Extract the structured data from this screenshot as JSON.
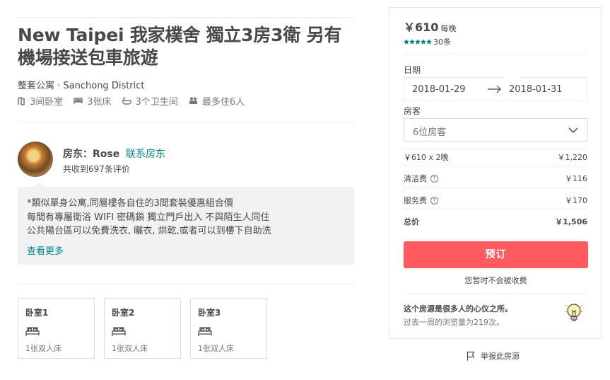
{
  "listing": {
    "title": "New Taipei 我家樸舍 獨立3房3衛 另有機場接送包車旅遊",
    "subtitle": "整套公寓 · Sanchong District",
    "bedrooms": "3间卧室",
    "beds": "3张床",
    "bathrooms": "3个卫生间",
    "guests": "最多住6人"
  },
  "host": {
    "name": "房东：Rose",
    "contact": "联系房东",
    "reviews": "共收到697条评价"
  },
  "description": {
    "lines": [
      "*類似單身公寓,同層樓各自住的3間套裝優惠組合價",
      "每間有專屬衛浴 WIFI 密碼鎖 獨立門戶出入 不與陌生人同住",
      "公共陽台區可以免費洗衣, 曬衣, 烘乾,或者可以到樓下自助洗"
    ],
    "read_more": "查看更多"
  },
  "rooms": [
    {
      "name": "卧室1",
      "bed": "1张双人床"
    },
    {
      "name": "卧室2",
      "bed": "1张双人床"
    },
    {
      "name": "卧室3",
      "bed": "1张双人床"
    }
  ],
  "booking": {
    "price": "￥610",
    "per_night": "每晚",
    "rating": 5,
    "review_count": "30条",
    "dates_label": "日期",
    "check_in": "2018-01-29",
    "check_out": "2018-01-31",
    "guests_label": "房客",
    "guests_value": "6位房客",
    "nights_line": "￥610 x 2晚",
    "nights_total": "￥1,220",
    "cleaning_label": "清洁费",
    "cleaning_fee": "￥116",
    "service_label": "服务费",
    "service_fee": "￥170",
    "total_label": "总价",
    "total": "￥1,506",
    "book_button": "预订",
    "no_charge": "您暂时不会被收费",
    "popular_title": "这个房源是很多人的心仪之所。",
    "popular_sub": "过去一周的浏览量为219次。"
  },
  "report": "举报此房源",
  "colors": {
    "accent": "#ff5a5f",
    "link": "#008489",
    "stars": "#008489"
  }
}
